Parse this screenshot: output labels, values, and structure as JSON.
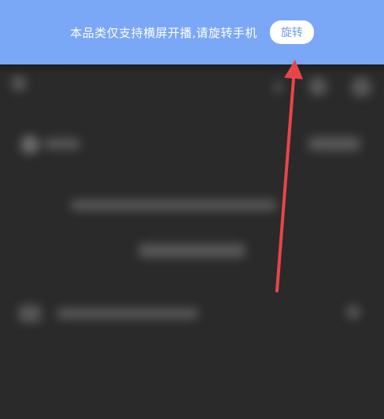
{
  "banner": {
    "message": "本品类仅支持横屏开播,请旋转手机",
    "rotate_button": "旋转",
    "background": "#7ba7f7"
  },
  "annotation": {
    "color": "#e8454a"
  }
}
